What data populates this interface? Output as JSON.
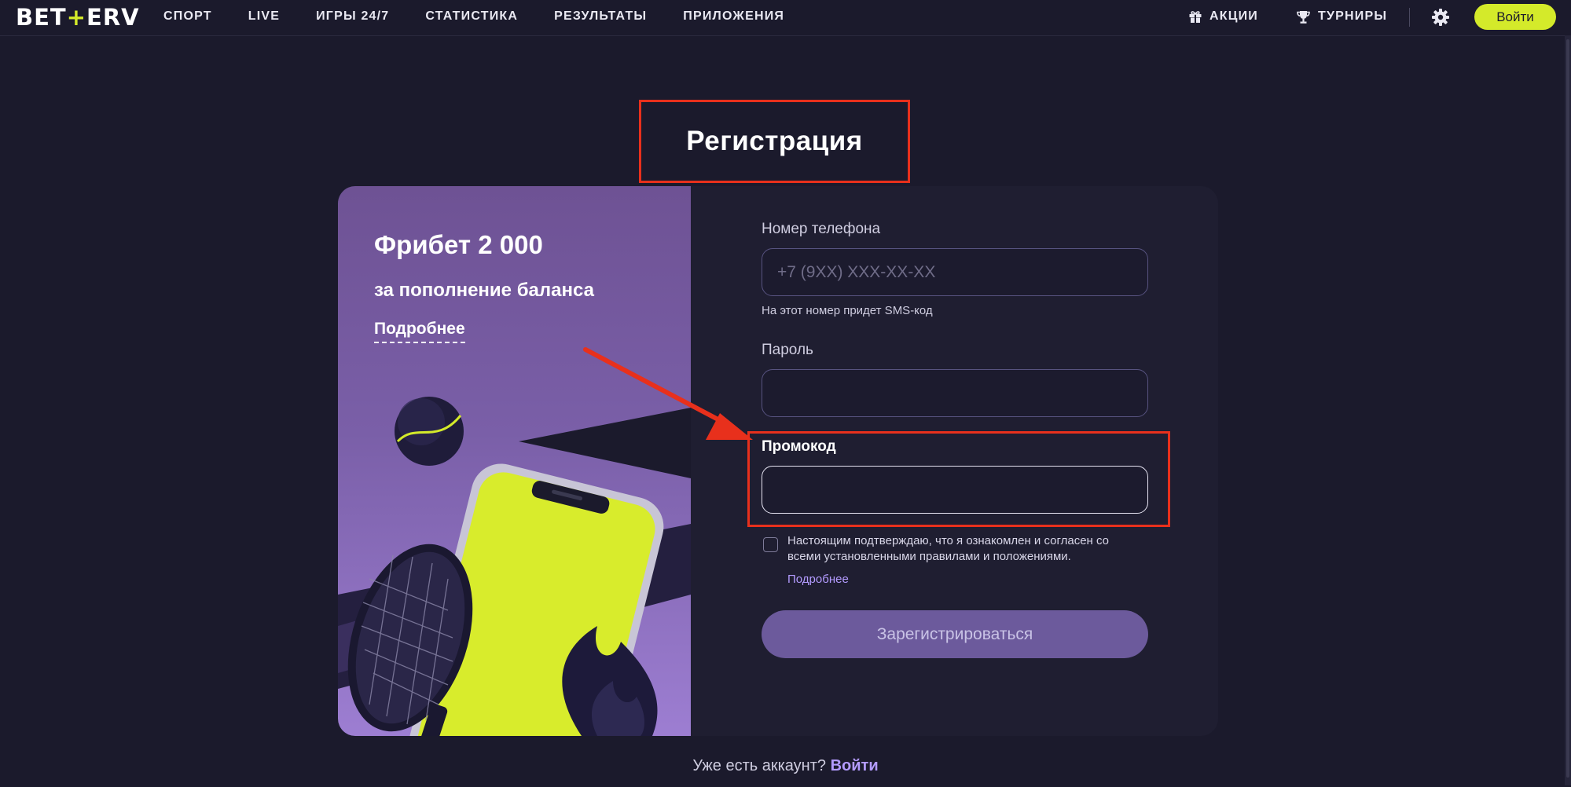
{
  "header": {
    "logo_left": "BET",
    "logo_plus": "+",
    "logo_right": "ERV",
    "nav": [
      "СПОРТ",
      "LIVE",
      "ИГРЫ 24/7",
      "СТАТИСТИКА",
      "РЕЗУЛЬТАТЫ",
      "ПРИЛОЖЕНИЯ"
    ],
    "promotions": "АКЦИИ",
    "tournaments": "ТУРНИРЫ",
    "login": "Войти"
  },
  "page": {
    "title": "Регистрация"
  },
  "promo": {
    "title": "Фрибет 2 000",
    "subtitle": "за пополнение баланса",
    "more": "Подробнее"
  },
  "form": {
    "phone_label": "Номер телефона",
    "phone_placeholder": "+7 (9XX) XXX-XX-XX",
    "phone_hint": "На этот номер придет SMS-код",
    "password_label": "Пароль",
    "password_value": "",
    "promocode_label": "Промокод",
    "promocode_value": "",
    "agree_checked": false,
    "agree_text": "Настоящим подтверждаю, что я ознакомлен и согласен со всеми установленными правилами и положениями.",
    "agree_more": "Подробнее",
    "submit": "Зарегистрироваться"
  },
  "footer": {
    "question": "Уже есть аккаунт?",
    "login": "Войти"
  },
  "colors": {
    "background": "#1b1a2c",
    "accent": "#d4ea2a",
    "highlight": "#e8301c",
    "link": "#b39bff",
    "button": "#6c5a9c"
  }
}
